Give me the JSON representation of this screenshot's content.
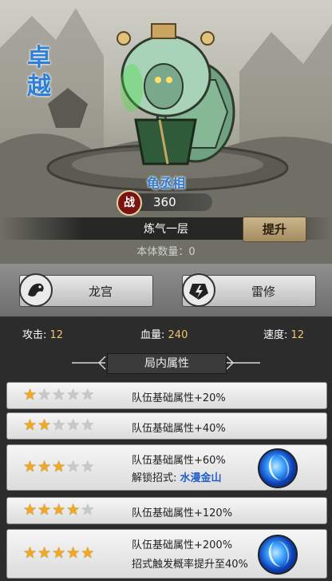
{
  "character": {
    "rarity_chars": [
      "卓",
      "越"
    ],
    "name": "龟丞相",
    "power_icon": "战",
    "power": "360",
    "realm": "炼气一层",
    "upgrade_label": "提升",
    "count_label": "本体数量：0"
  },
  "tags": [
    {
      "label": "龙宫",
      "icon": "dragon-emblem-icon"
    },
    {
      "label": "雷修",
      "icon": "lightning-emblem-icon"
    }
  ],
  "stats": {
    "attack_label": "攻击:",
    "attack": "12",
    "hp_label": "血量:",
    "hp": "240",
    "speed_label": "速度:",
    "speed": "12"
  },
  "section_title": "局内属性",
  "levels": [
    {
      "stars": 1,
      "text": "队伍基础属性+20%"
    },
    {
      "stars": 2,
      "text": "队伍基础属性+40%"
    },
    {
      "stars": 3,
      "text": "队伍基础属性+60%",
      "extra_label": "解锁招式: ",
      "skill_name": "水漫金山",
      "skill_icon": "water-skill-icon"
    },
    {
      "stars": 4,
      "text": "队伍基础属性+120%"
    },
    {
      "stars": 5,
      "text": "队伍基础属性+200%",
      "extra_label": "招式触发概率提升至40%",
      "skill_icon": "water-skill-icon"
    }
  ],
  "colors": {
    "rarity": "#2f7fd6",
    "star_on": "#f2a91e",
    "stat_value": "#f2c46b",
    "skill_name": "#2060c8"
  }
}
